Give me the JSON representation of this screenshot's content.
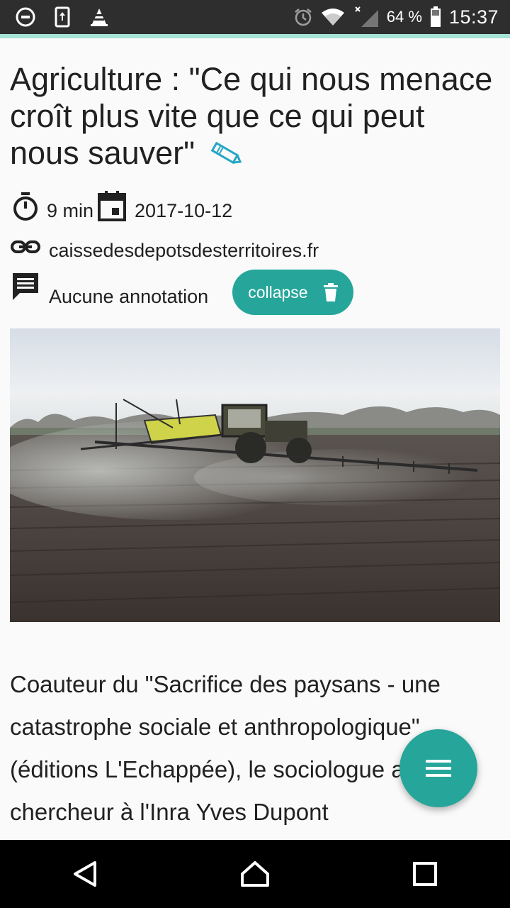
{
  "status_bar": {
    "icons_left": [
      "do-not-disturb-icon",
      "screen-rotation-icon",
      "vlc-cone-icon"
    ],
    "icons_right": [
      "alarm-icon",
      "wifi-icon",
      "signal-icon",
      "battery-icon"
    ],
    "battery": "64 %",
    "time": "15:37"
  },
  "article": {
    "title": "Agriculture : \"Ce qui nous menace croît plus vite que ce qui peut nous sauver\"",
    "reading_time": "9 min",
    "date": "2017-10-12",
    "source": "caissedesdepotsdesterritoires.fr",
    "annotations": "Aucune annotation",
    "collapse_label": "collapse",
    "body": "Coauteur du \"Sacrifice des paysans - une catastrophe sociale et anthropologique\" (éditions L'Echappée), le sociologue ancien chercheur à l'Inra Yves Dupont"
  },
  "colors": {
    "accent": "#26a69a",
    "accent_line": "#a6e3d6",
    "status_bar": "#2e2e2e",
    "nav_bar": "#000000"
  }
}
